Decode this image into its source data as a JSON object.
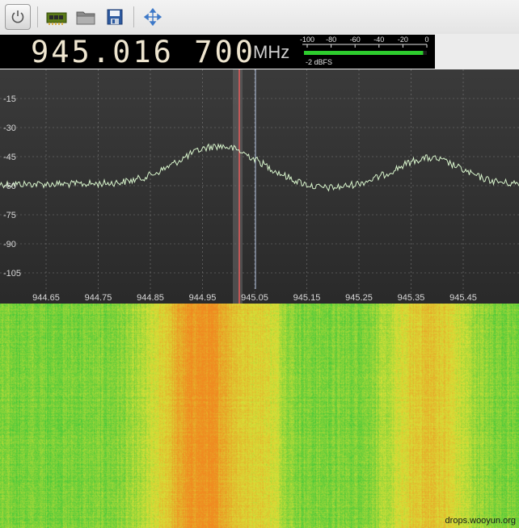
{
  "toolbar": {
    "buttons": [
      {
        "name": "power-icon",
        "title": "Start / Stop"
      },
      {
        "name": "input-device-icon",
        "title": "Configure I/O devices"
      },
      {
        "name": "folder-open-icon",
        "title": "Load settings"
      },
      {
        "name": "save-icon",
        "title": "Save settings"
      },
      {
        "name": "move-icon",
        "title": "Toggle fullscreen"
      }
    ]
  },
  "frequency": {
    "digits": "945.016 700",
    "unit": "MHz"
  },
  "meter": {
    "scale": [
      "-100",
      "-80",
      "-60",
      "-40",
      "-20",
      "0"
    ],
    "readout": "-2 dBFS",
    "level": 0.97,
    "bar_color": "#2ecc2e"
  },
  "spectrum": {
    "y_ticks": [
      "-15",
      "-30",
      "-45",
      "-60",
      "-75",
      "-90",
      "-105"
    ],
    "x_ticks": [
      "944.65",
      "944.75",
      "944.85",
      "944.95",
      "945.05",
      "945.15",
      "945.25",
      "945.35",
      "945.45"
    ],
    "trace_color": "#d8f5cc",
    "tuned_line_color": "#e85a5a",
    "cursor_color": "#b8c8e6",
    "background_top": "#3a3a3a",
    "background_bottom": "#2a2a2a"
  },
  "waterfall": {
    "colors": [
      "#44c83a",
      "#d8e038",
      "#f08a20"
    ]
  },
  "watermark": "drops.wooyun.org"
}
